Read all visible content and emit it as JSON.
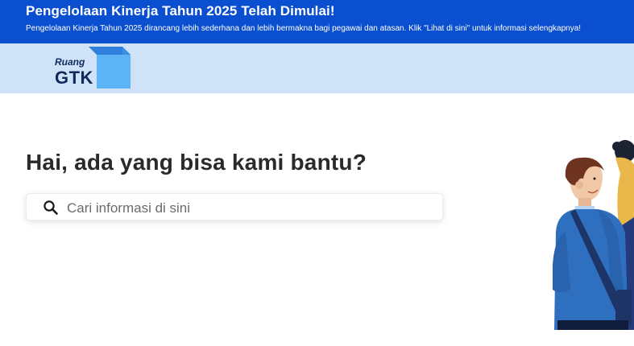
{
  "banner": {
    "title": "Pengelolaan Kinerja Tahun 2025 Telah Dimulai!",
    "description": "Pengelolaan Kinerja Tahun 2025 dirancang lebih sederhana dan lebih bermakna bagi pegawai dan atasan. Klik \"Lihat di sini\" untuk informasi selengkapnya!",
    "background": "#0b4fd1"
  },
  "header": {
    "logo_small": "Ruang",
    "logo_big": "GTK",
    "background": "#cfe2f8"
  },
  "hero": {
    "title": "Hai, ada yang bisa kami bantu?"
  },
  "search": {
    "placeholder": "Cari informasi di sini",
    "value": "",
    "icon": "search-icon"
  }
}
